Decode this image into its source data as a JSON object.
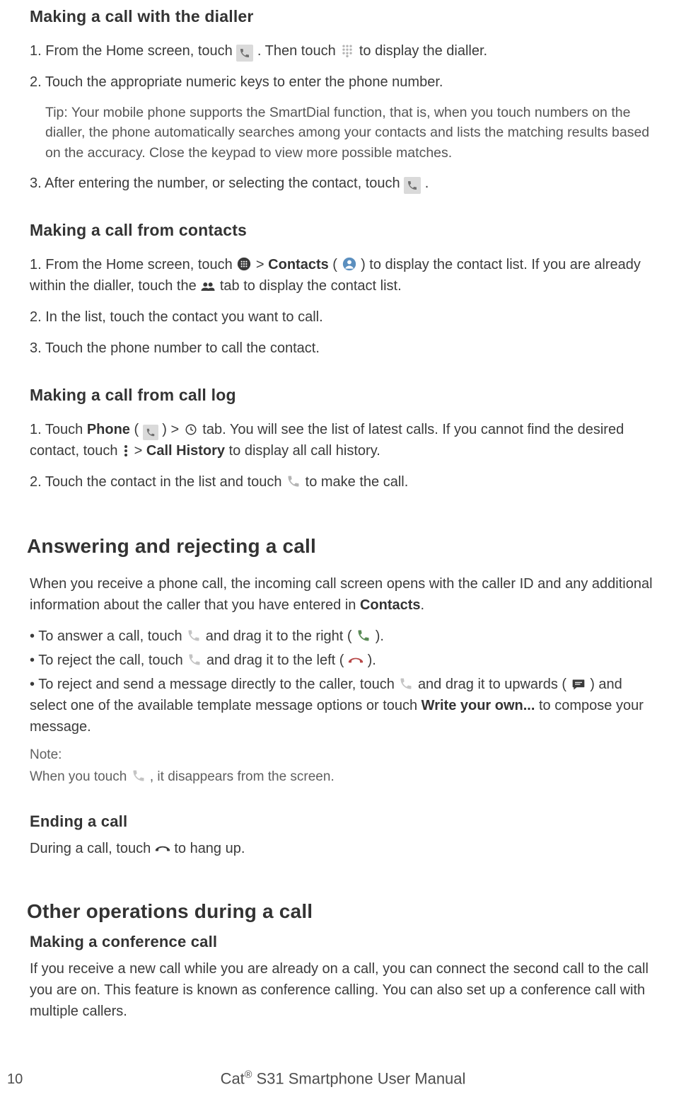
{
  "section1": {
    "title": "Making a call with the dialler",
    "step1a": "1. From the Home screen, touch ",
    "step1b": ". Then touch ",
    "step1c": " to display the dialler.",
    "step2": "2. Touch the appropriate numeric keys to enter the phone number.",
    "tip": "Tip: Your mobile phone supports the SmartDial function, that is, when you touch numbers on the dialler, the phone automatically searches among your contacts and lists the matching results based on the accuracy. Close the keypad to view more possible matches.",
    "step3a": "3. After entering the number, or selecting the contact, touch ",
    "step3b": "."
  },
  "section2": {
    "title": "Making a call from contacts",
    "s1a": "1. From the Home screen, touch ",
    "s1b": " > ",
    "contacts": "Contacts",
    "s1c": " (",
    "s1d": ") to display the contact list. If you are already within the dialler, touch the ",
    "s1e": " tab to display the contact list.",
    "s2": "2. In the list, touch the contact you want to call.",
    "s3": "3. Touch the phone number to call the contact."
  },
  "section3": {
    "title": "Making a call from call log",
    "s1a": "1. Touch ",
    "phone": "Phone",
    "s1b": " ( ",
    "s1c": " ) > ",
    "s1d": " tab. You will see the list of latest calls. If you cannot find the desired contact, touch ",
    "s1e": "> ",
    "callhistory": "Call History",
    "s1f": " to display all call history.",
    "s2a": "2. Touch the contact in the list and touch ",
    "s2b": " to make the call."
  },
  "section4": {
    "title": "Answering and rejecting a call",
    "intro_a": "When you receive a phone call, the incoming call screen opens with the caller ID and any additional information about the caller that you have entered in ",
    "contacts": "Contacts",
    "intro_b": ".",
    "b1a": "• To answer a call, touch ",
    "b1b": " and drag it to the right (",
    "b1c": ").",
    "b2a": "• To reject the call, touch ",
    "b2b": " and drag it to the left (",
    "b2c": ").",
    "b3a": "• To reject and send a message directly to the caller, touch ",
    "b3b": " and drag it to upwards (",
    "b3c": ") and select one of the available template message options or touch ",
    "wyo": "Write your own...",
    "b3d": " to compose your message.",
    "note_label": "Note:",
    "note_a": "When you touch ",
    "note_b": ", it disappears from the screen."
  },
  "section5": {
    "title": "Ending a call",
    "body_a": "During a call, touch ",
    "body_b": " to hang up."
  },
  "section6": {
    "title": "Other operations during a call",
    "subtitle": "Making a conference call",
    "body": "If you receive a new call while you are already on a call, you can connect the second call to the call you are on. This feature is known as conference calling. You can also set up a conference call with multiple callers."
  },
  "footer": {
    "page": "10",
    "title_a": "Cat",
    "title_b": " S31 Smartphone User Manual",
    "reg": "®"
  }
}
